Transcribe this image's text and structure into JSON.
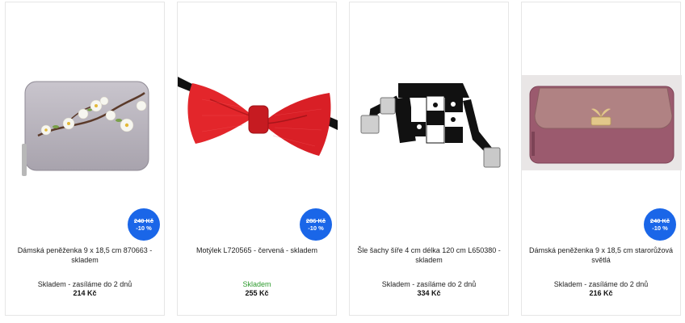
{
  "products": [
    {
      "name": "Dámská peněženka 9 x 18,5 cm 870663 - skladem",
      "image": "lavender-wallet-with-blossoms",
      "old_price": "240 Kč",
      "discount": "-10 %",
      "stock": "Skladem - zasíláme do 2 dnů",
      "price": "214 Kč"
    },
    {
      "name": "Motýlek L720565 - červená - skladem",
      "image": "red-bow-tie",
      "old_price": "286 Kč",
      "discount": "-10 %",
      "stock": "Skladem",
      "stock_color": "#2e9b2e",
      "price": "255 Kč"
    },
    {
      "name": "Šle šachy šíře 4 cm délka 120 cm L650380 - skladem",
      "image": "chess-pattern-suspenders",
      "stock": "Skladem - zasíláme do 2 dnů",
      "price": "334 Kč"
    },
    {
      "name": "Dámská peněženka 9 x 18,5 cm starorůžová světlá",
      "image": "pink-wallet-with-clasp",
      "old_price": "240 Kč",
      "discount": "-10 %",
      "stock": "Skladem - zasíláme do 2 dnů",
      "price": "216 Kč"
    }
  ],
  "colors": {
    "badge": "#1a66e8",
    "in_stock": "#2e9b2e"
  }
}
